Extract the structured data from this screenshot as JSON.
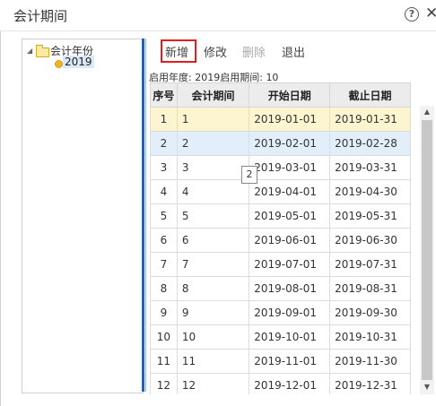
{
  "window": {
    "title": "会计期间",
    "help_icon": "help-circle-icon",
    "close_icon": "close-icon"
  },
  "tree": {
    "root_label": "会计年份",
    "root_icon": "folder-icon",
    "children": [
      {
        "label": "2019",
        "icon": "dot-icon"
      }
    ]
  },
  "toolbar": {
    "add": "新增",
    "edit": "修改",
    "delete": "删除",
    "exit": "退出",
    "highlight_color": "#e02020"
  },
  "info": {
    "enabled_year_label": "启用年度:",
    "enabled_year": "2019",
    "enabled_period_label": "启用期间:",
    "enabled_period": "10"
  },
  "table": {
    "columns": [
      "序号",
      "会计期间",
      "开始日期",
      "截止日期"
    ],
    "rows": [
      [
        "1",
        "1",
        "2019-01-01",
        "2019-01-31"
      ],
      [
        "2",
        "2",
        "2019-02-01",
        "2019-02-28"
      ],
      [
        "3",
        "3",
        "2019-03-01",
        "2019-03-31"
      ],
      [
        "4",
        "4",
        "2019-04-01",
        "2019-04-30"
      ],
      [
        "5",
        "5",
        "2019-05-01",
        "2019-05-31"
      ],
      [
        "6",
        "6",
        "2019-06-01",
        "2019-06-30"
      ],
      [
        "7",
        "7",
        "2019-07-01",
        "2019-07-31"
      ],
      [
        "8",
        "8",
        "2019-08-01",
        "2019-08-31"
      ],
      [
        "9",
        "9",
        "2019-09-01",
        "2019-09-30"
      ],
      [
        "10",
        "10",
        "2019-10-01",
        "2019-10-31"
      ],
      [
        "11",
        "11",
        "2019-11-01",
        "2019-11-30"
      ],
      [
        "12",
        "12",
        "2019-12-01",
        "2019-12-31"
      ]
    ],
    "selected_row_color": "#fdf5cf",
    "hover_row_color": "#e3eefb"
  },
  "tooltip": {
    "text": "2"
  },
  "colors": {
    "splitter": "#2b5fa6"
  }
}
